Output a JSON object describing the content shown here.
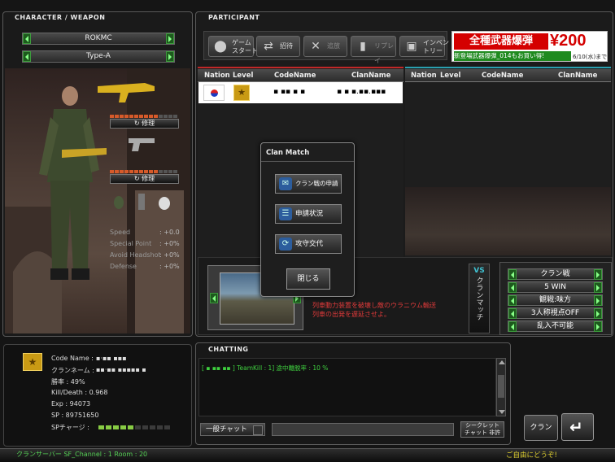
{
  "left_panel": {
    "title": "CHARACTER / WEAPON",
    "character_select": "ROKMC",
    "type_select": "Type-A",
    "repair_label": "修理",
    "stats": [
      {
        "label": "Speed",
        "value": ": +0.0"
      },
      {
        "label": "Special Point",
        "value": ": +0%"
      },
      {
        "label": "Avoid Headshot",
        "value": ": +0%"
      },
      {
        "label": "Defense",
        "value": ": +0%"
      }
    ]
  },
  "profile": {
    "code_name_label": "Code Name :",
    "code_name_value": "▪·▪▪   ▪▪▪",
    "clan_label": "クランネーム :",
    "clan_value": "▪▪·▪▪ ▪▪▪▪▪  ▪",
    "win_rate": "勝率 : 49%",
    "kill_death": "Kill/Death : 0.968",
    "exp": "Exp : 94073",
    "sp": "SP : 89751650",
    "sp_charge_label": "SPチャージ :",
    "sp_charge_filled": 5,
    "sp_charge_total": 10
  },
  "participant": {
    "title": "PARTICIPANT",
    "buttons": [
      {
        "label": "ゲーム\nスタート",
        "icon": "game-start-icon",
        "glyph": "⬤"
      },
      {
        "label": "招待",
        "icon": "invite-icon",
        "glyph": "⇄"
      },
      {
        "label": "追放",
        "icon": "kick-icon",
        "glyph": "✕"
      },
      {
        "label": "リプレイ",
        "icon": "replay-icon",
        "glyph": "▮"
      },
      {
        "label": "インベン\nトリー",
        "icon": "inventory-icon",
        "glyph": "▣"
      }
    ],
    "columns": [
      "Nation",
      "Level",
      "CodeName",
      "ClanName"
    ],
    "player_row": {
      "codename": "▪ ▪▪ ▪   ▪",
      "clanname": "▪ ▪ ▪.▪▪.▪▪▪"
    },
    "ad": {
      "title": "全種武器爆弾",
      "price": "¥200",
      "subtitle": "新登場武器爆弾_014もお買い得!",
      "date": "6/10(水)まで"
    }
  },
  "clan_match_popup": {
    "title": "Clan Match",
    "buttons": [
      "クラン戦の申請",
      "申請状況",
      "攻守交代"
    ],
    "close": "閉じる"
  },
  "map": {
    "description": "列車動力装置を破壊し敵のウラニウム輸送\n列車の出発を遅延させよ。",
    "vs_label": "VS",
    "mode_label": "クランマッチ"
  },
  "settings": [
    "クラン戦",
    "5 WIN",
    "観戦:味方",
    "3人称視点OFF",
    "乱入不可能"
  ],
  "chatting": {
    "title": "CHATTING",
    "message": "[ ▪ ▪▪  ▪▪ ] TeamKill : 1] 途中離脱率 : 10 %",
    "channel_select": "一般チャット",
    "secret_chat": "シークレット\nチャット 非許",
    "clan_button": "クラン"
  },
  "status_bar": {
    "server_info": "クランサーバー SF_Channel : 1 Room : 20",
    "greeting": "ご自由にどうぞ!"
  }
}
